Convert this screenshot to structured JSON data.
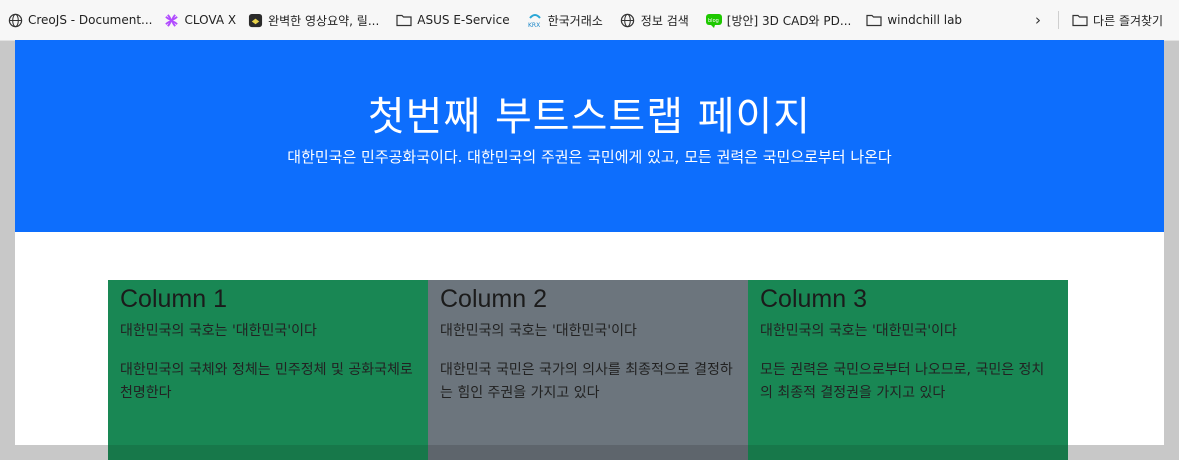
{
  "bookmarks": [
    {
      "icon": "globe-icon",
      "label": "CreoJS - Document..."
    },
    {
      "icon": "clova-icon",
      "label": "CLOVA X"
    },
    {
      "icon": "summary-app-icon",
      "label": "완벽한 영상요약, 릴..."
    },
    {
      "icon": "folder-icon",
      "label": "ASUS E-Service"
    },
    {
      "icon": "krx-icon",
      "label": "한국거래소"
    },
    {
      "icon": "globe-icon",
      "label": "정보 검색"
    },
    {
      "icon": "blog-icon",
      "label": "[방안] 3D CAD와 PD..."
    },
    {
      "icon": "folder-icon",
      "label": "windchill lab"
    }
  ],
  "other_bookmarks": {
    "icon": "folder-icon",
    "label": "다른 즐겨찾기"
  },
  "hero": {
    "title": "첫번째 부트스트랩 페이지",
    "subtitle": "대한민국은 민주공화국이다. 대한민국의 주권은 국민에게 있고, 모든 권력은 국민으로부터 나온다"
  },
  "columns": [
    {
      "heading": "Column 1",
      "line1": "대한민국의 국호는 '대한민국'이다",
      "line2": "대한민국의 국체와 정체는 민주정체 및 공화국체로 천명한다",
      "color": "#198754"
    },
    {
      "heading": "Column 2",
      "line1": "대한민국의 국호는 '대한민국'이다",
      "line2": "대한민국 국민은 국가의 의사를 최종적으로 결정하는 힘인 주권을 가지고 있다",
      "color": "#6c757d"
    },
    {
      "heading": "Column 3",
      "line1": "대한민국의 국호는 '대한민국'이다",
      "line2": "모든 권력은 국민으로부터 나오므로, 국민은 정치의 최종적 결정권을 가지고 있다",
      "color": "#198754"
    }
  ],
  "colors": {
    "primary": "#0d6efd",
    "success": "#198754",
    "secondary": "#6c757d"
  }
}
